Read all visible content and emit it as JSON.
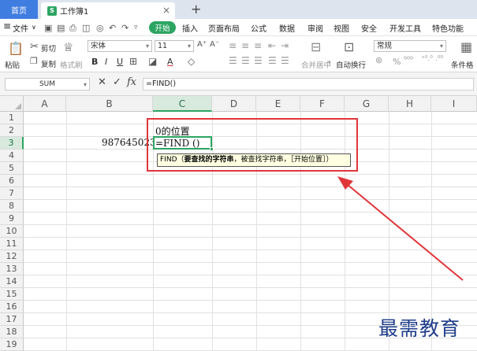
{
  "tabs": {
    "home": "首页",
    "doc_icon": "S",
    "doc_title": "工作簿1",
    "close": "×",
    "add": "+"
  },
  "menu": {
    "file": "文件",
    "items": [
      "开始",
      "插入",
      "页面布局",
      "公式",
      "数据",
      "审阅",
      "视图",
      "安全",
      "开发工具",
      "特色功能"
    ]
  },
  "toolbar": {
    "paste": "粘贴",
    "cut": "剪切",
    "copy": "复制",
    "format_painter": "格式刷",
    "font_name": "宋体",
    "font_size": "11",
    "bold": "B",
    "italic": "I",
    "underline": "U",
    "font_color": "A",
    "merge": "合并居中",
    "wrap": "自动换行",
    "number_format": "常规",
    "percent": "%",
    "cond_format": "条件格式"
  },
  "formula_bar": {
    "name_box": "SUM",
    "cancel": "✕",
    "confirm": "✓",
    "fx": "fx",
    "formula": "=FIND()"
  },
  "grid": {
    "columns": [
      "A",
      "B",
      "C",
      "D",
      "E",
      "F",
      "G",
      "H",
      "I"
    ],
    "active_column": "C",
    "rows": [
      "1",
      "2",
      "3",
      "4",
      "5",
      "6",
      "7",
      "8",
      "9",
      "10",
      "11",
      "12",
      "13",
      "14",
      "15",
      "16",
      "17",
      "18",
      "19"
    ],
    "active_row": "3",
    "cells": {
      "C2": "0的位置",
      "B3": "9876450231",
      "C3": "=FIND ()"
    },
    "tooltip": {
      "fn": "FIND（",
      "arg1": "要查找的字符串",
      "rest": "，被查找字符串，［开始位置］）"
    }
  },
  "annotation": {
    "color": "#e0363a"
  },
  "watermark": "最需教育",
  "colors": {
    "accent": "#2da562",
    "home_tab": "#3f7de0"
  }
}
